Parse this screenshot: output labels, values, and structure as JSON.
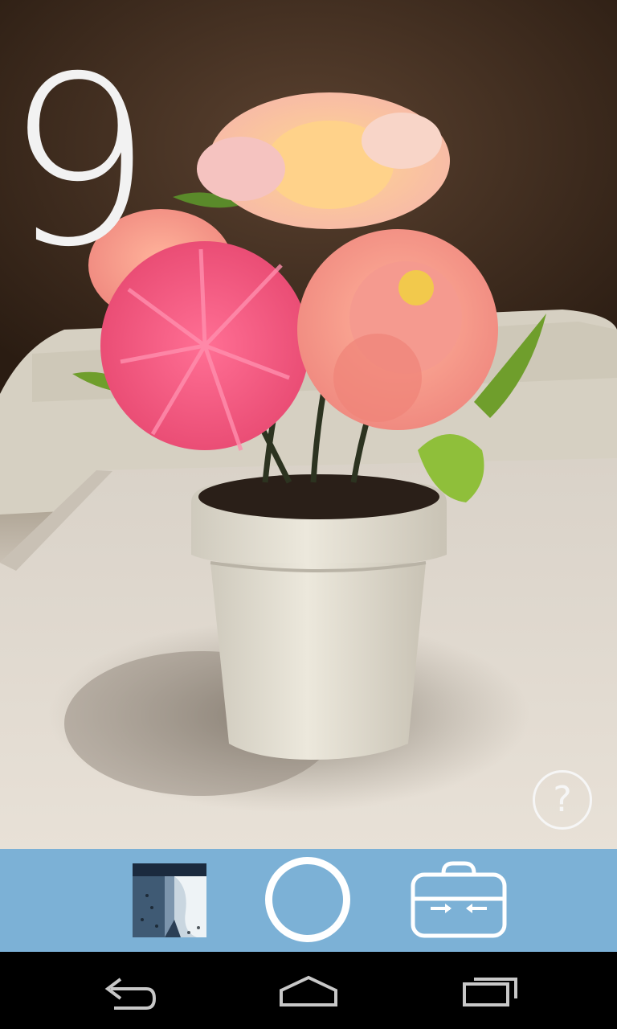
{
  "viewfinder": {
    "countdown_value": "9",
    "help_label": "?"
  },
  "controls": {
    "gallery_thumbnail_icon": "gallery-thumbnail",
    "shutter_icon": "shutter-circle",
    "switch_camera_icon": "camera-switch-icon"
  },
  "navigation": {
    "back_icon": "back-icon",
    "home_icon": "home-icon",
    "recents_icon": "recents-icon"
  },
  "colors": {
    "control_bar": "#7cb1d6",
    "control_foreground": "#ffffff",
    "nav_bar": "#000000",
    "nav_icon": "#c8c8c8"
  }
}
